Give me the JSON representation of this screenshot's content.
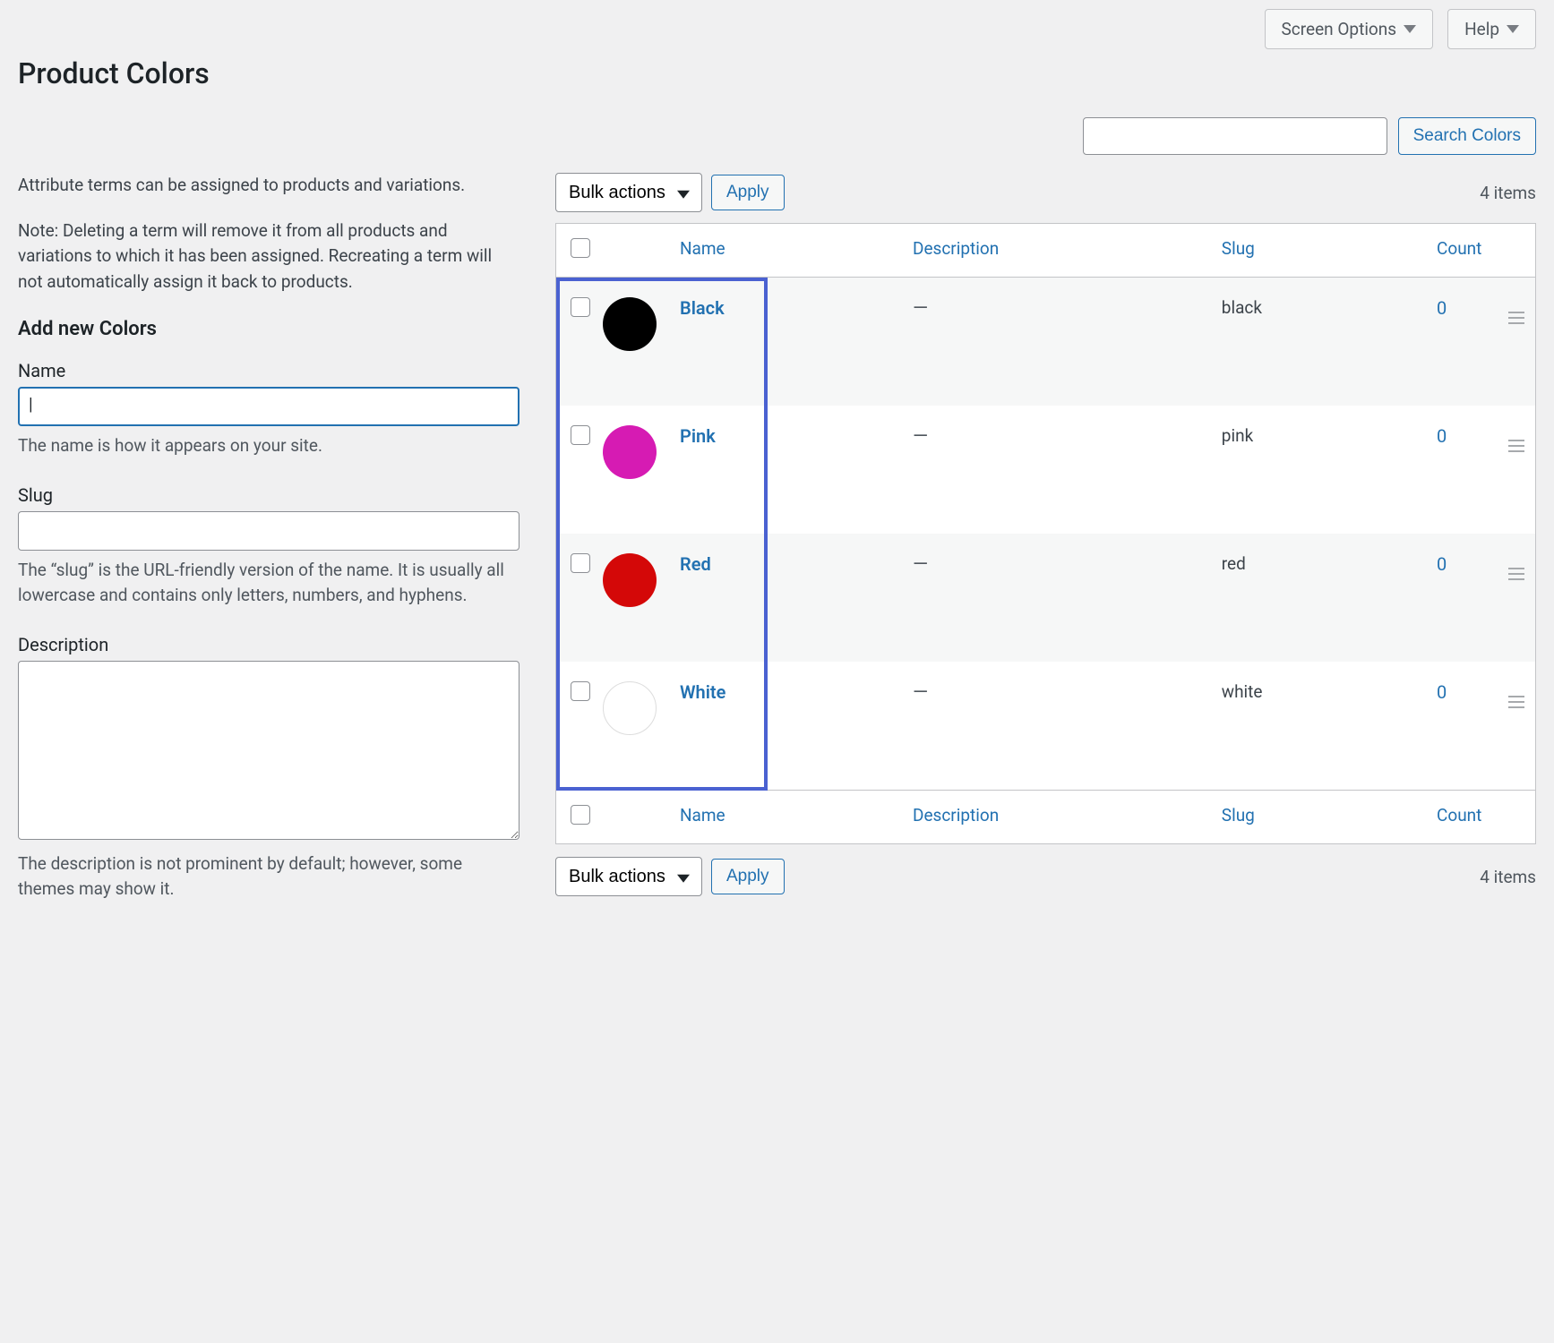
{
  "topTabs": {
    "screenOptions": "Screen Options",
    "help": "Help"
  },
  "pageTitle": "Product Colors",
  "search": {
    "button": "Search Colors"
  },
  "intro": {
    "p1": "Attribute terms can be assigned to products and variations.",
    "p2": "Note: Deleting a term will remove it from all products and variations to which it has been assigned. Recreating a term will not automatically assign it back to products."
  },
  "form": {
    "heading": "Add new Colors",
    "name": {
      "label": "Name",
      "help": "The name is how it appears on your site."
    },
    "slug": {
      "label": "Slug",
      "help": "The “slug” is the URL-friendly version of the name. It is usually all lowercase and contains only letters, numbers, and hyphens."
    },
    "description": {
      "label": "Description",
      "help": "The description is not prominent by default; however, some themes may show it."
    }
  },
  "bulk": {
    "label": "Bulk actions",
    "apply": "Apply"
  },
  "itemsText": "4 items",
  "columns": {
    "name": "Name",
    "description": "Description",
    "slug": "Slug",
    "count": "Count"
  },
  "rows": [
    {
      "name": "Black",
      "slug": "black",
      "description": "—",
      "count": "0",
      "color": "#000000",
      "isWhite": false
    },
    {
      "name": "Pink",
      "slug": "pink",
      "description": "—",
      "count": "0",
      "color": "#d61bb3",
      "isWhite": false
    },
    {
      "name": "Red",
      "slug": "red",
      "description": "—",
      "count": "0",
      "color": "#d40808",
      "isWhite": false
    },
    {
      "name": "White",
      "slug": "white",
      "description": "—",
      "count": "0",
      "color": "#ffffff",
      "isWhite": true
    }
  ]
}
